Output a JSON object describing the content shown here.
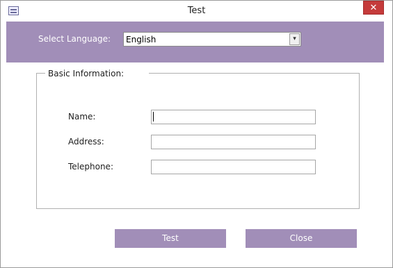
{
  "window": {
    "title": "Test",
    "close_glyph": "✕"
  },
  "header": {
    "language_label": "Select Language:",
    "language_value": "English",
    "dropdown_glyph": "▾"
  },
  "group": {
    "legend": "Basic Information:"
  },
  "fields": [
    {
      "label": "Name:",
      "value": ""
    },
    {
      "label": "Address:",
      "value": ""
    },
    {
      "label": "Telephone:",
      "value": ""
    }
  ],
  "buttons": {
    "test_label": "Test",
    "close_label": "Close"
  },
  "colors": {
    "accent": "#a18eb8",
    "close_red": "#c53b3b"
  }
}
